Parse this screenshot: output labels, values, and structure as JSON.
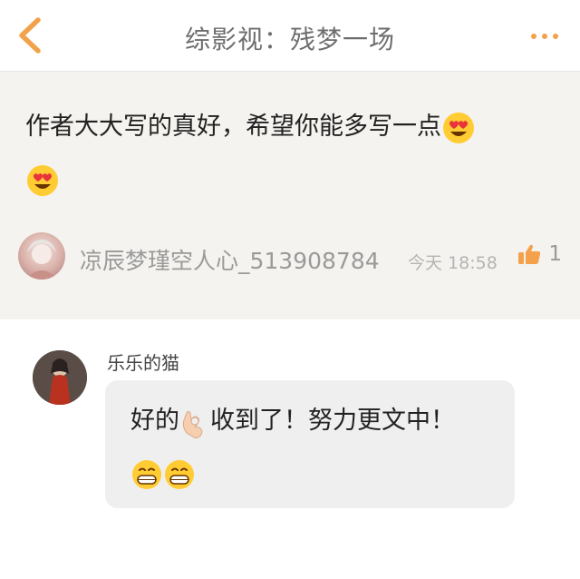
{
  "header": {
    "title": "综影视：残梦一场",
    "back_icon": "chevron-left-icon",
    "more_icon": "more-dots-icon",
    "accent": "#f5a04a"
  },
  "comment": {
    "text": "作者大大写的真好，希望你能多写一点",
    "emoji": "heart-eyes-emoji",
    "author": "凉辰梦瑾空人心_513908784",
    "time": "今天 18:58",
    "likes": "1",
    "background": "#f4f3ef"
  },
  "reply": {
    "author": "乐乐的猫",
    "text_part1": "好的",
    "text_part2": "收到了！努力更文中！",
    "emojis": [
      "ok-hand-emoji",
      "grinning-emoji"
    ]
  }
}
